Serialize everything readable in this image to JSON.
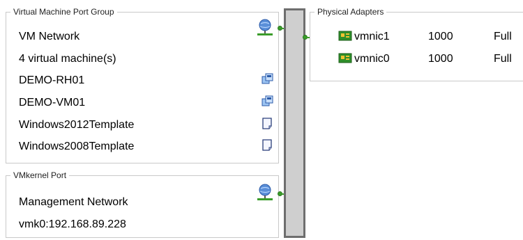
{
  "vm_port_group": {
    "legend": "Virtual Machine Port Group",
    "network_name": "VM Network",
    "vm_count": "4 virtual machine(s)",
    "machines": [
      {
        "name": "DEMO-RH01",
        "icon": "vm-icon"
      },
      {
        "name": "DEMO-VM01",
        "icon": "vm-icon"
      },
      {
        "name": "Windows2012Template",
        "icon": "template-icon"
      },
      {
        "name": "Windows2008Template",
        "icon": "template-icon"
      }
    ]
  },
  "vmkernel_port": {
    "legend": "VMkernel Port",
    "network_name": "Management Network",
    "vmk_address": "vmk0:192.168.89.228"
  },
  "physical_adapters": {
    "legend": "Physical Adapters",
    "adapters": [
      {
        "name": "vmnic1",
        "speed": "1000",
        "duplex": "Full"
      },
      {
        "name": "vmnic0",
        "speed": "1000",
        "duplex": "Full"
      }
    ]
  },
  "colors": {
    "link_green": "#3a9c2a",
    "switch_fill": "#cfcfcf",
    "switch_border": "#6e6e6e",
    "group_border": "#c9c9c9"
  }
}
